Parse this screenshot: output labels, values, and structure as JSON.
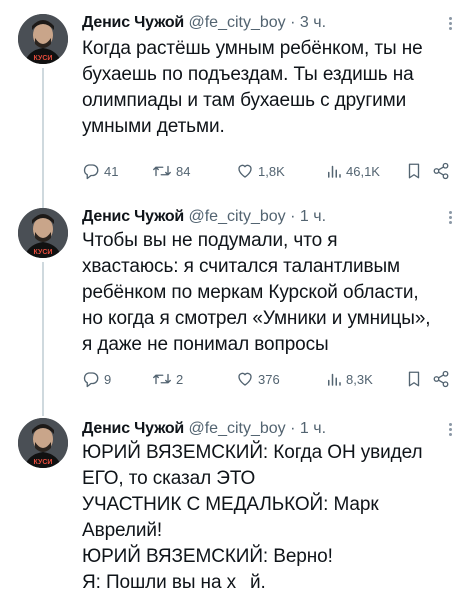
{
  "tweets": [
    {
      "author_name": "Денис Чужой",
      "handle": "@fe_city_boy",
      "separator": "·",
      "time": "3 ч.",
      "avatar_caption": "КУСИ",
      "lines": [
        "Когда растёшь умным ребёнком, ты не",
        "бухаешь по подъездам. Ты ездишь на",
        "олимпиады и там бухаешь с другими",
        "умными детьми."
      ],
      "stats": {
        "replies": "41",
        "retweets": "84",
        "likes": "1,8K",
        "views": "46,1K"
      }
    },
    {
      "author_name": "Денис Чужой",
      "handle": "@fe_city_boy",
      "separator": "·",
      "time": "1 ч.",
      "avatar_caption": "КУСИ",
      "lines": [
        "Чтобы вы не подумали, что я",
        "хвастаюсь: я считался талантливым",
        "ребёнком по меркам Курской области,",
        "но когда я смотрел «Умники и умницы»,",
        "я даже не понимал вопросы"
      ],
      "stats": {
        "replies": "9",
        "retweets": "2",
        "likes": "376",
        "views": "8,3K"
      }
    },
    {
      "author_name": "Денис Чужой",
      "handle": "@fe_city_boy",
      "separator": "·",
      "time": "1 ч.",
      "avatar_caption": "КУСИ",
      "lines": [
        "ЮРИЙ ВЯЗЕМСКИЙ: Когда ОН увидел",
        "ЕГО, то сказал ЭТО",
        "УЧАСТНИК С МЕДАЛЬКОЙ: Марк",
        "Аврелий!",
        "ЮРИЙ ВЯЗЕМСКИЙ: Верно!"
      ],
      "last_line_start": "Я: Пошли вы на х",
      "last_line_end": "й."
    }
  ],
  "colors": {
    "text": "#0f1419",
    "muted": "#536471",
    "thread_line": "#cfd9de"
  },
  "icons": [
    "reply-icon",
    "retweet-icon",
    "like-icon",
    "views-icon",
    "bookmark-icon",
    "share-icon",
    "more-options-icon"
  ]
}
